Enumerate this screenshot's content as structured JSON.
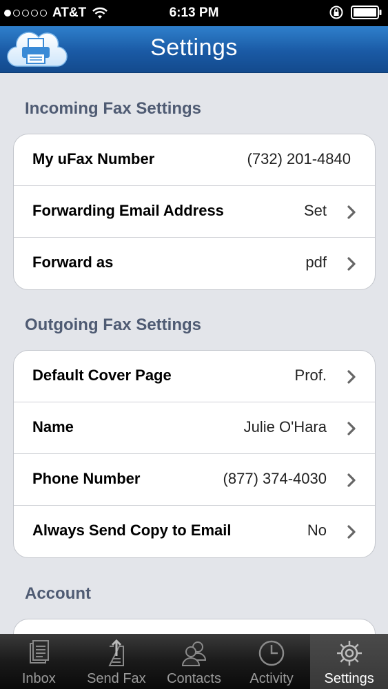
{
  "status_bar": {
    "carrier": "AT&T",
    "time": "6:13 PM",
    "signal_bars": 1,
    "signal_total": 5
  },
  "header": {
    "title": "Settings",
    "logo_icon": "cloud-fax-icon"
  },
  "sections": {
    "incoming": {
      "title": "Incoming Fax Settings",
      "rows": [
        {
          "label": "My uFax Number",
          "value": "(732) 201-4840"
        },
        {
          "label": "Forwarding Email Address",
          "value": "Set"
        },
        {
          "label": "Forward as",
          "value": "pdf"
        }
      ]
    },
    "outgoing": {
      "title": "Outgoing Fax Settings",
      "rows": [
        {
          "label": "Default Cover Page",
          "value": "Prof."
        },
        {
          "label": "Name",
          "value": "Julie O'Hara"
        },
        {
          "label": "Phone Number",
          "value": "(877) 374-4030"
        },
        {
          "label": "Always Send Copy to Email",
          "value": "No"
        }
      ]
    },
    "account": {
      "title": "Account"
    }
  },
  "tabs": [
    {
      "label": "Inbox",
      "icon": "inbox-icon"
    },
    {
      "label": "Send Fax",
      "icon": "send-fax-icon"
    },
    {
      "label": "Contacts",
      "icon": "contacts-icon"
    },
    {
      "label": "Activity",
      "icon": "clock-icon"
    },
    {
      "label": "Settings",
      "icon": "gear-icon",
      "active": true
    }
  ],
  "colors": {
    "nav_blue": "#1a5aa5",
    "section_header": "#4f5b73",
    "background": "#e3e5ea"
  }
}
